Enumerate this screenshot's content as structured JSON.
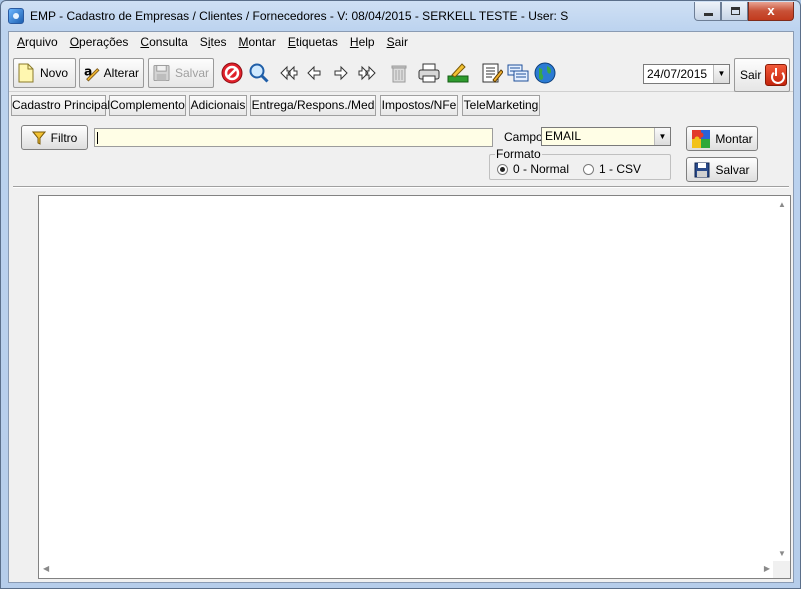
{
  "window": {
    "title": "EMP - Cadastro de Empresas / Clientes / Fornecedores - V: 08/04/2015 - SERKELL TESTE - User: S",
    "close_glyph": "x"
  },
  "menu": {
    "items": [
      {
        "acc": "A",
        "rest": "rquivo"
      },
      {
        "acc": "O",
        "rest": "perações"
      },
      {
        "acc": "C",
        "rest": "onsulta"
      },
      {
        "pre": "S",
        "acc": "i",
        "rest": "tes"
      },
      {
        "acc": "M",
        "rest": "ontar"
      },
      {
        "acc": "E",
        "rest": "tiquetas"
      },
      {
        "acc": "H",
        "rest": "elp"
      },
      {
        "acc": "S",
        "rest": "air"
      }
    ]
  },
  "toolbar": {
    "novo_label": "Novo",
    "alterar_label": "Alterar",
    "salvar_label": "Salvar",
    "date_value": "24/07/2015",
    "sair_label": "Sair",
    "dropdown_glyph": "▼"
  },
  "tabs": [
    "Cadastro Principal",
    "Complemento",
    "Adicionais",
    "Entrega/Respons./Med",
    "Impostos/NFe",
    "TeleMarketing"
  ],
  "filter": {
    "filtro_label": "Filtro",
    "filter_value": "",
    "campo_label": "Campo",
    "campo_value": "EMAIL",
    "formato_label": "Formato",
    "option_normal": "0 - Normal",
    "option_csv": "1 - CSV",
    "selected_format": "0 - Normal",
    "montar_label": "Montar",
    "salvar_label": "Salvar"
  },
  "icons": {
    "app": "app-icon",
    "novo": "new-document-icon",
    "alterar": "edit-text-icon",
    "salvar": "floppy-disk-icon",
    "cancel": "cancel-icon",
    "search": "magnifier-icon",
    "first": "first-record-icon",
    "prev": "previous-record-icon",
    "next": "next-record-icon",
    "last": "last-record-icon",
    "delete": "trash-icon",
    "print": "printer-icon",
    "approve": "approve-icon",
    "notes": "notes-icon",
    "transfer": "transfer-icon",
    "globe": "globe-icon",
    "power": "power-icon",
    "funnel": "funnel-icon",
    "puzzle": "puzzle-icon"
  },
  "colors": {
    "input_bg": "#fffee6",
    "close_button": "#c23b1e",
    "window_frame": "#bcd3ef"
  }
}
